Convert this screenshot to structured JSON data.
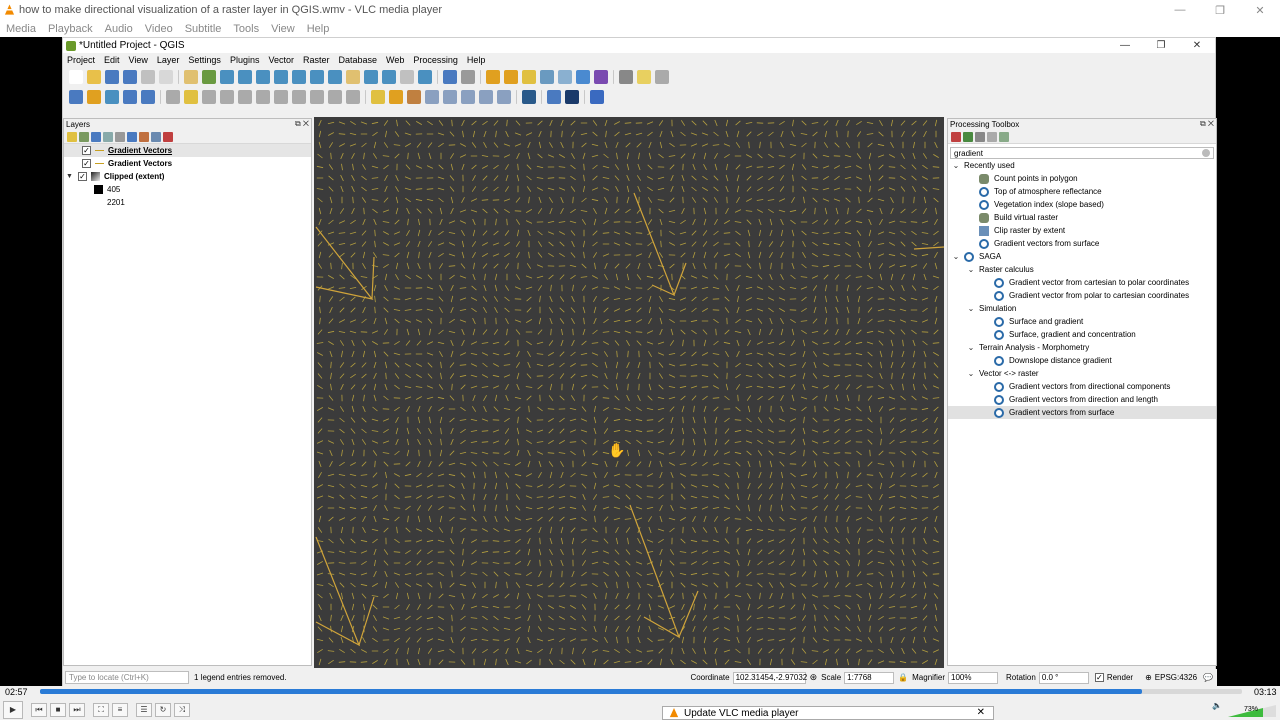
{
  "vlc": {
    "title": "how to make directional visualization of a raster layer in QGIS.wmv - VLC media player",
    "menu": [
      "Media",
      "Playback",
      "Audio",
      "Video",
      "Subtitle",
      "Tools",
      "View",
      "Help"
    ],
    "time_elapsed": "02:57",
    "time_total": "03:13",
    "progress": 0.917,
    "volume": "73%",
    "update_dialog": "Update VLC media player"
  },
  "qgis": {
    "title": "*Untitled Project - QGIS",
    "menu": [
      "Project",
      "Edit",
      "View",
      "Layer",
      "Settings",
      "Plugins",
      "Vector",
      "Raster",
      "Database",
      "Web",
      "Processing",
      "Help"
    ],
    "layers_panel": {
      "title": "Layers",
      "items": [
        {
          "label": "Gradient Vectors",
          "checked": true,
          "selected": true
        },
        {
          "label": "Gradient Vectors",
          "checked": true,
          "selected": false
        },
        {
          "label": "Clipped (extent)",
          "checked": true,
          "selected": false
        }
      ],
      "legend": [
        "405",
        "2201"
      ]
    },
    "toolbox": {
      "title": "Processing Toolbox",
      "search": "gradient",
      "tree": [
        {
          "label": "Recently used",
          "level": 0,
          "toggle": "v",
          "icon": "none"
        },
        {
          "label": "Count points in polygon",
          "level": 1,
          "toggle": "",
          "icon": "gear"
        },
        {
          "label": "Top of atmosphere reflectance",
          "level": 1,
          "toggle": "",
          "icon": "saga"
        },
        {
          "label": "Vegetation index (slope based)",
          "level": 1,
          "toggle": "",
          "icon": "saga"
        },
        {
          "label": "Build virtual raster",
          "level": 1,
          "toggle": "",
          "icon": "gear"
        },
        {
          "label": "Clip raster by extent",
          "level": 1,
          "toggle": "",
          "icon": "grid"
        },
        {
          "label": "Gradient vectors from surface",
          "level": 1,
          "toggle": "",
          "icon": "saga"
        },
        {
          "label": "SAGA",
          "level": 0,
          "toggle": "v",
          "icon": "saga"
        },
        {
          "label": "Raster calculus",
          "level": 1,
          "toggle": "v",
          "icon": "none"
        },
        {
          "label": "Gradient vector from cartesian to polar coordinates",
          "level": 2,
          "toggle": "",
          "icon": "saga"
        },
        {
          "label": "Gradient vector from polar to cartesian coordinates",
          "level": 2,
          "toggle": "",
          "icon": "saga"
        },
        {
          "label": "Simulation",
          "level": 1,
          "toggle": "v",
          "icon": "none"
        },
        {
          "label": "Surface and gradient",
          "level": 2,
          "toggle": "",
          "icon": "saga"
        },
        {
          "label": "Surface, gradient and concentration",
          "level": 2,
          "toggle": "",
          "icon": "saga"
        },
        {
          "label": "Terrain Analysis - Morphometry",
          "level": 1,
          "toggle": "v",
          "icon": "none"
        },
        {
          "label": "Downslope distance gradient",
          "level": 2,
          "toggle": "",
          "icon": "saga"
        },
        {
          "label": "Vector <-> raster",
          "level": 1,
          "toggle": "v",
          "icon": "none"
        },
        {
          "label": "Gradient vectors from directional components",
          "level": 2,
          "toggle": "",
          "icon": "saga"
        },
        {
          "label": "Gradient vectors from direction and length",
          "level": 2,
          "toggle": "",
          "icon": "saga"
        },
        {
          "label": "Gradient vectors from surface",
          "level": 2,
          "toggle": "",
          "icon": "saga",
          "selected": true
        }
      ]
    },
    "status": {
      "locate_placeholder": "Type to locate (Ctrl+K)",
      "message": "1 legend entries removed.",
      "coordinate_label": "Coordinate",
      "coordinate": "102.31454,-2.97032",
      "scale_label": "Scale",
      "scale": "1:7768",
      "magnifier_label": "Magnifier",
      "magnifier": "100%",
      "rotation_label": "Rotation",
      "rotation": "0.0 °",
      "render_label": "Render",
      "crs": "EPSG:4326"
    }
  }
}
